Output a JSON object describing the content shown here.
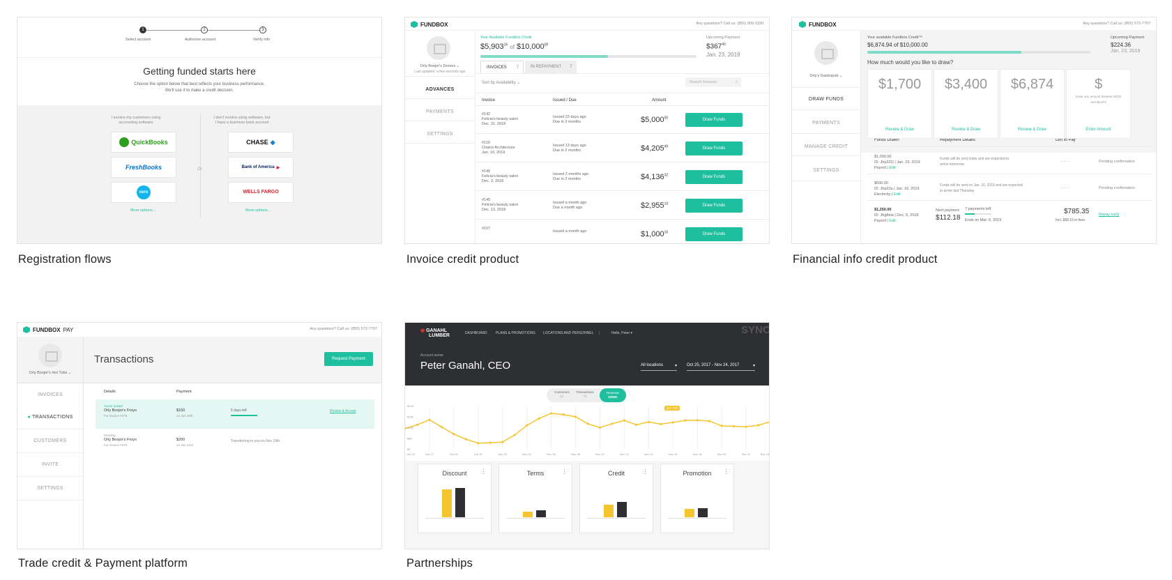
{
  "captions": {
    "c1": "Registration flows",
    "c2": "Invoice credit product",
    "c3": "Financial info credit product",
    "c4": "Trade credit & Payment platform",
    "c5": "Partnerships"
  },
  "registration": {
    "steps": [
      "Select account",
      "Authorize account",
      "Verify info"
    ],
    "step_nums": [
      "1",
      "2",
      "3"
    ],
    "title": "Getting funded starts here",
    "subtitle1": "Choose the option below that best reflects your business performance.",
    "subtitle2": "We'll use it to make a credit decision.",
    "left_text1": "I invoice my customers using",
    "left_text2": "accounting software",
    "right_text1": "I don't invoice using software, but",
    "right_text2": "I have a business bank account",
    "or": "Or",
    "logos_left": [
      "QuickBooks",
      "FreshBooks",
      "xero"
    ],
    "logos_right": [
      "CHASE",
      "Bank of America",
      "WELLS FARGO"
    ],
    "more_left": "More options...",
    "more_right": "More options..."
  },
  "invoice": {
    "brand": "FUNDBOX",
    "questions": "Any questions? Call us: (855) 909-3330",
    "account": "Orly Boojor's Drones",
    "updated": "Last updated: a few seconds ago",
    "credit_label": "Your Available Fundbox Credit",
    "credit_amount": "$5,903",
    "credit_cents": "16",
    "credit_of": "of",
    "credit_total": "$10,000",
    "credit_total_cents": "00",
    "credit_fraction": 0.59,
    "upcoming_label": "Upcoming Payment",
    "upcoming_amount": "$367",
    "upcoming_cents": "43",
    "upcoming_date": "Jan. 23, 2019",
    "tabs": [
      "INVOICES",
      "IN REPAYMENT"
    ],
    "tab_counts": [
      "7",
      "7"
    ],
    "side": [
      "ADVANCES",
      "PAYMENTS",
      "SETTINGS"
    ],
    "sort": "Sort by Availability",
    "search_placeholder": "Search Invoices",
    "headers": [
      "Invoice",
      "Issued / Due",
      "Amount"
    ],
    "rows": [
      {
        "num": "#142",
        "client": "Felicia's beauty salon",
        "date": "Dec. 31, 2018",
        "issued": "Issued 23 days ago",
        "due": "Due in 3 months",
        "amount": "$5,000",
        "cents": "00",
        "action": "Draw Funds"
      },
      {
        "num": "#119",
        "client": "Chains Architecture",
        "date": "Jan. 10, 2019",
        "issued": "Issued 13 days ago",
        "due": "Due in 2 months",
        "amount": "$4,205",
        "cents": "49",
        "action": "Draw Funds"
      },
      {
        "num": "#145",
        "client": "Felicia's beauty salon",
        "date": "Dec. 3, 2018",
        "issued": "Issued 2 months ago",
        "due": "Due in 2 months",
        "amount": "$4,136",
        "cents": "32",
        "action": "Draw Funds"
      },
      {
        "num": "#145",
        "client": "Felicia's beauty salon",
        "date": "Dec. 13, 2018",
        "issued": "Issued a month ago",
        "due": "Due a month ago",
        "amount": "$2,955",
        "cents": "13",
        "action": "Draw Funds"
      },
      {
        "num": "#107",
        "client": "",
        "date": "",
        "issued": "Issued a month ago",
        "due": "",
        "amount": "$1,000",
        "cents": "16",
        "action": "Draw Funds"
      }
    ]
  },
  "financial": {
    "brand": "FUNDBOX",
    "questions": "Any questions? Call us: (855) 572-7707",
    "account": "Orly's Gastropub",
    "credit_label": "Your available Fundbox Credit™",
    "credit_amount": "$6,874.94 of $10,000.00",
    "credit_fraction": 0.69,
    "upcoming_label": "Upcoming Payment",
    "upcoming_amount": "$224.36",
    "upcoming_date": "Jan. 23, 2019",
    "question": "How much would you like to draw?",
    "side": [
      "DRAW FUNDS",
      "PAYMENTS",
      "MANAGE CREDIT",
      "SETTINGS"
    ],
    "cards": [
      {
        "amount": "$1,700",
        "action": "Review & Draw",
        "note": ""
      },
      {
        "amount": "$3,400",
        "action": "Review & Draw",
        "note": ""
      },
      {
        "amount": "$6,874",
        "action": "Review & Draw",
        "note": ""
      },
      {
        "amount": "$",
        "action": "Enter Amount",
        "note": "Enter any amount between $100 and $6,874"
      }
    ],
    "headers": [
      "Funds Drawn",
      "Repayment Details",
      "Left to Pay"
    ],
    "rows": [
      {
        "amount": "$1,000.00",
        "id": "ID: Jhp32O | Jan. 23, 2019",
        "purpose": "Payroll |",
        "edit": "Edit",
        "details": "Funds will be sent today and are expected to arrive tomorrow",
        "left": "- - - -",
        "status": "Pending confirmation"
      },
      {
        "amount": "$500.00",
        "id": "ID: Jhp22a | Jan. 16, 2019",
        "purpose": "Electricity |",
        "edit": "Edit",
        "details": "Funds will be sent on Jan. 16, 2019 and are expected to arrive last Thursday",
        "left": "- - - -",
        "status": "Pending confirmation"
      },
      {
        "amount": "$1,250.00",
        "id": "ID: Jhg8eia | Dec. 5, 2018",
        "purpose": "Payroll |",
        "edit": "Edit",
        "next_label": "Next payment",
        "next_amount": "$112.18",
        "payments_left": "7 payments left",
        "ends": "Ends on Mar. 6, 2019",
        "left": "$785.35",
        "fees": "Incl. $58.15 in fees",
        "status": "Repay early"
      }
    ]
  },
  "trade": {
    "brand": "FUNDBOX",
    "brand_suffix": "PAY",
    "questions": "Any questions? Call us: (855) 572-7707",
    "account": "Orly Boojor's Hot Tubs",
    "title": "Transactions",
    "request": "Request Payment",
    "side": [
      "INVOICES",
      "TRANSACTIONS",
      "CUSTOMERS",
      "INVITE",
      "SETTINGS"
    ],
    "headers": [
      "Details",
      "Payment"
    ],
    "rows": [
      {
        "status": "You're invited",
        "name": "Orly Boojor's Froyo",
        "invoice": "For invoice #476",
        "amount": "$150",
        "on": "on Jan 29th",
        "info": "5 days left",
        "action": "Review & Accept"
      },
      {
        "status": "Pending",
        "name": "Orly Boojor's Froyo",
        "invoice": "For invoice #476",
        "amount": "$200",
        "on": "on Jan 23rd",
        "info": "Transferring to you on Nov 19th",
        "action": ""
      }
    ]
  },
  "partners": {
    "logo1": "GANAHL",
    "logo2": "LUMBER",
    "sync": "SYNC.",
    "nav": [
      "DASHBOARD",
      "PLANS & PROMOTIONS",
      "LOCATIONS AND PERSONNEL",
      "|",
      "Hello, Peter ▾"
    ],
    "owner_label": "Account owner",
    "owner": "Peter Ganahl, CEO",
    "filter1": "All locations",
    "filter2": "Oct 25, 2017 - Nov 24, 2017",
    "toggles": [
      {
        "label": "Customers",
        "value": "62"
      },
      {
        "label": "Transactions",
        "value": "70"
      },
      {
        "label": "Revenue",
        "value": "$350K"
      }
    ],
    "tooltip": "$17,722",
    "cards": [
      "Discount",
      "Terms",
      "Credit",
      "Promotion"
    ]
  },
  "chart_data": {
    "type": "line",
    "x": [
      "Oct 25",
      "Oct 26",
      "Oct 27",
      "Oct 28",
      "Oct 29",
      "Oct 30",
      "Oct 31",
      "Nov 01",
      "Nov 02",
      "Nov 03",
      "Nov 04",
      "Nov 05",
      "Nov 06",
      "Nov 07",
      "Nov 08",
      "Nov 09",
      "Nov 10",
      "Nov 11",
      "Nov 12",
      "Nov 13",
      "Nov 14",
      "Nov 15",
      "Nov 16",
      "Nov 17",
      "Nov 18",
      "Nov 19",
      "Nov 20",
      "Nov 21",
      "Nov 22",
      "Nov 23",
      "Nov 24"
    ],
    "x_ticks": [
      "Oct 25",
      "Oct 27",
      "Oct 29",
      "Oct 31",
      "Nov 02",
      "Nov 04",
      "Nov 06",
      "Nov 08",
      "Nov 10",
      "Nov 12",
      "Nov 14",
      "Nov 16",
      "Nov 18",
      "Nov 20",
      "Nov 22",
      "Nov 24"
    ],
    "y_ticks": [
      "$20K",
      "$15K",
      "$10K",
      "$5K",
      "$0"
    ],
    "values": [
      9.8,
      11.5,
      13.8,
      10.5,
      7.2,
      4.8,
      3.0,
      3.2,
      3.5,
      6.8,
      11.2,
      14.4,
      16.8,
      16.2,
      15.2,
      12.0,
      10.2,
      12.0,
      13.5,
      11.5,
      12.8,
      11.8,
      12.6,
      13.5,
      13.6,
      13.2,
      11.0,
      10.8,
      10.6,
      11.3,
      12.9
    ],
    "ylim": [
      0,
      20
    ],
    "color": "#f5c530"
  }
}
